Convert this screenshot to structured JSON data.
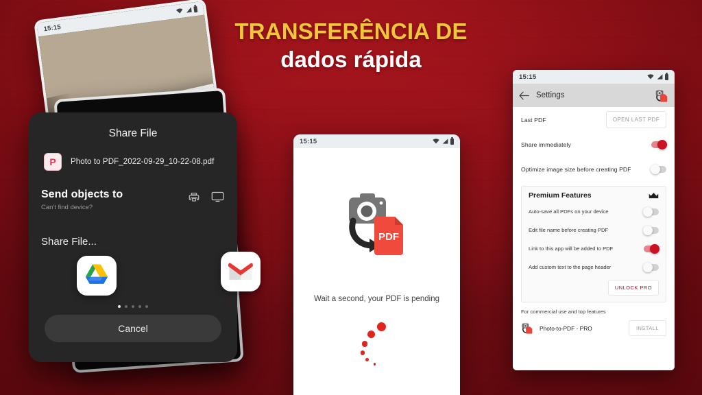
{
  "headline": {
    "line1": "TRANSFERÊNCIA DE",
    "line2": "dados rápida",
    "color_line1": "#F2C63C",
    "color_line2": "#FFFFFF"
  },
  "background": {
    "top_color": "#b5171f",
    "bottom_color": "#6b1016"
  },
  "status_bar": {
    "time": "15:15",
    "icons": [
      "wifi-icon",
      "signal-icon",
      "battery-icon"
    ]
  },
  "left_device": {
    "status_time": "15:15",
    "content_description": "photo of a document on a desk"
  },
  "share_sheet": {
    "title": "Share File",
    "file": {
      "icon": "pdf-p-icon",
      "icon_letter": "P",
      "name": "Photo to PDF_2022-09-29_10-22-08.pdf"
    },
    "send_objects": {
      "label": "Send objects to",
      "sublabel": "Can't find device?",
      "icons": [
        "printer-icon",
        "cast-screen-icon"
      ]
    },
    "share_label": "Share File...",
    "apps": [
      {
        "name": "Google Drive",
        "icon": "google-drive-icon"
      },
      {
        "name": "Gmail",
        "icon": "gmail-icon"
      }
    ],
    "pager": {
      "total": 5,
      "active_index": 0
    },
    "cancel_label": "Cancel"
  },
  "center_phone": {
    "status_time": "15:15",
    "artwork": "camera-to-pdf-icon",
    "pdf_badge_text": "PDF",
    "message": "Wait a second, your PDF is pending",
    "spinner": "loading-dots-spinner",
    "spinner_color": "#e0251b"
  },
  "settings_phone": {
    "status_time": "15:15",
    "appbar": {
      "back_icon": "back-arrow-icon",
      "title": "Settings",
      "app_icon": "photo-to-pdf-app-icon"
    },
    "rows": [
      {
        "label": "Last PDF",
        "control": "button",
        "button_label": "OPEN LAST PDF"
      },
      {
        "label": "Share immediately",
        "control": "toggle",
        "state": "on"
      },
      {
        "label": "Optimize image size before creating PDF",
        "control": "toggle",
        "state": "off"
      }
    ],
    "premium": {
      "title": "Premium Features",
      "crown_icon": "crown-icon",
      "rows": [
        {
          "label": "Auto-save all PDFs on your device",
          "state": "off"
        },
        {
          "label": "Edit file name before creating PDF",
          "state": "off"
        },
        {
          "label": "Link to this app will be added to PDF",
          "state": "on"
        },
        {
          "label": "Add custom text to the page header",
          "state": "off"
        }
      ],
      "unlock_label": "UNLOCK PRO"
    },
    "promo": {
      "text": "For commercial use and top features",
      "app_icon": "photo-to-pdf-app-icon",
      "app_name": "Photo-to-PDF - PRO",
      "install_label": "INSTALL"
    },
    "accent_color": "#cc1122"
  }
}
